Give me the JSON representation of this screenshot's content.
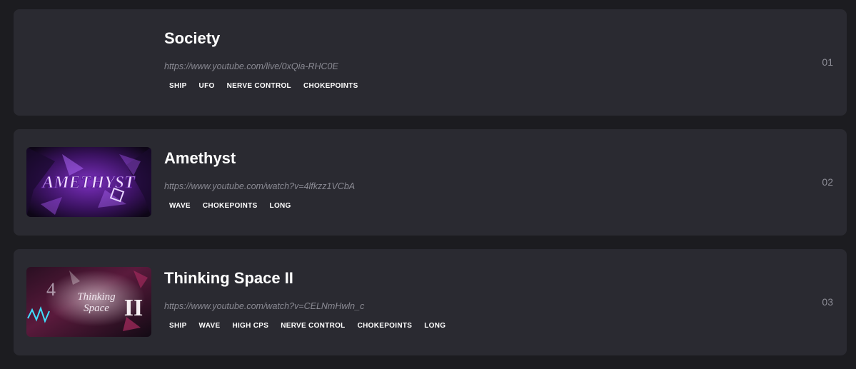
{
  "levels": [
    {
      "title": "Society",
      "url": "https://www.youtube.com/live/0xQia-RHC0E",
      "tags": [
        "SHIP",
        "UFO",
        "NERVE CONTROL",
        "CHOKEPOINTS"
      ],
      "rank": "01",
      "thumbnail": "none"
    },
    {
      "title": "Amethyst",
      "url": "https://www.youtube.com/watch?v=4lfkzz1VCbA",
      "tags": [
        "WAVE",
        "CHOKEPOINTS",
        "LONG"
      ],
      "rank": "02",
      "thumbnail": "amethyst-thumbnail",
      "thumb_text": "AMETHYST",
      "thumb_colors": [
        "#1a0a2e",
        "#7b2fbe",
        "#d9a6ff"
      ]
    },
    {
      "title": "Thinking Space II",
      "url": "https://www.youtube.com/watch?v=CELNmHwln_c",
      "tags": [
        "SHIP",
        "WAVE",
        "HIGH CPS",
        "NERVE CONTROL",
        "CHOKEPOINTS",
        "LONG"
      ],
      "rank": "03",
      "thumbnail": "thinking-space-thumbnail",
      "thumb_text": "Thinking Space II",
      "thumb_colors": [
        "#120a14",
        "#c0306a",
        "#40e0ff"
      ]
    }
  ],
  "colors": {
    "page_bg": "#1c1c20",
    "card_bg": "#2a2a31",
    "title": "#ffffff",
    "url": "#8a8a93",
    "rank": "#8d8d96"
  }
}
